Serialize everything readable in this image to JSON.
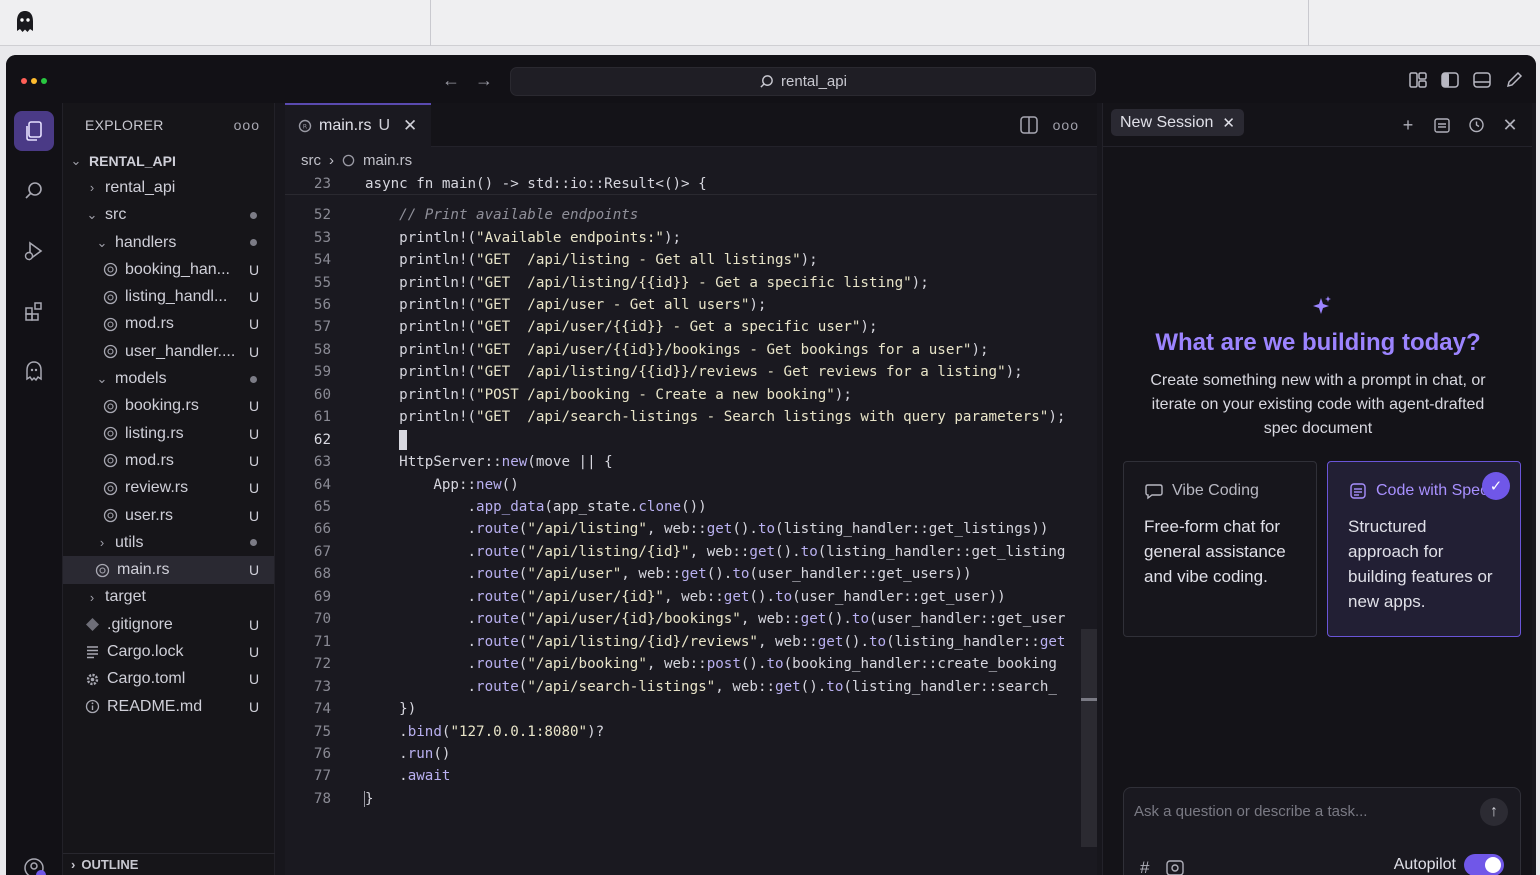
{
  "window": {
    "search_text": "rental_api"
  },
  "explorer": {
    "title": "EXPLORER",
    "more": "ooo",
    "root": "RENTAL_API",
    "items": [
      {
        "label": "rental_api",
        "indent": 1,
        "type": "folder-closed",
        "badge": ""
      },
      {
        "label": "src",
        "indent": 1,
        "type": "folder-open",
        "badge": "dot"
      },
      {
        "label": "handlers",
        "indent": 2,
        "type": "folder-open",
        "badge": "dot"
      },
      {
        "label": "booking_han...",
        "indent": 3,
        "type": "rs",
        "badge": "U"
      },
      {
        "label": "listing_handl...",
        "indent": 3,
        "type": "rs",
        "badge": "U"
      },
      {
        "label": "mod.rs",
        "indent": 3,
        "type": "rs",
        "badge": "U"
      },
      {
        "label": "user_handler....",
        "indent": 3,
        "type": "rs",
        "badge": "U"
      },
      {
        "label": "models",
        "indent": 2,
        "type": "folder-open",
        "badge": "dot"
      },
      {
        "label": "booking.rs",
        "indent": 3,
        "type": "rs",
        "badge": "U"
      },
      {
        "label": "listing.rs",
        "indent": 3,
        "type": "rs",
        "badge": "U"
      },
      {
        "label": "mod.rs",
        "indent": 3,
        "type": "rs",
        "badge": "U"
      },
      {
        "label": "review.rs",
        "indent": 3,
        "type": "rs",
        "badge": "U"
      },
      {
        "label": "user.rs",
        "indent": 3,
        "type": "rs",
        "badge": "U"
      },
      {
        "label": "utils",
        "indent": 2,
        "type": "folder-closed",
        "badge": "dot"
      },
      {
        "label": "main.rs",
        "indent": 2,
        "type": "rs",
        "badge": "U",
        "selected": true
      },
      {
        "label": "target",
        "indent": 1,
        "type": "folder-closed",
        "badge": ""
      },
      {
        "label": ".gitignore",
        "indent": 1,
        "type": "git",
        "badge": "U"
      },
      {
        "label": "Cargo.lock",
        "indent": 1,
        "type": "lock",
        "badge": "U"
      },
      {
        "label": "Cargo.toml",
        "indent": 1,
        "type": "gear",
        "badge": "U"
      },
      {
        "label": "README.md",
        "indent": 1,
        "type": "info",
        "badge": "U"
      }
    ],
    "outline": "OUTLINE"
  },
  "editor": {
    "tab_label": "main.rs",
    "tab_status": "U",
    "tab_close": "✕",
    "breadcrumb": [
      "src",
      "main.rs"
    ],
    "sticky_line": {
      "num": "23",
      "text": "async fn main() -> std::io::Result<()> {"
    },
    "lines": [
      {
        "num": "52",
        "text": "    // Print available endpoints",
        "kind": "comment"
      },
      {
        "num": "53",
        "text": "    println!(\"Available endpoints:\");"
      },
      {
        "num": "54",
        "text": "    println!(\"GET  /api/listing - Get all listings\");"
      },
      {
        "num": "55",
        "text": "    println!(\"GET  /api/listing/{{id}} - Get a specific listing\");"
      },
      {
        "num": "56",
        "text": "    println!(\"GET  /api/user - Get all users\");"
      },
      {
        "num": "57",
        "text": "    println!(\"GET  /api/user/{{id}} - Get a specific user\");"
      },
      {
        "num": "58",
        "text": "    println!(\"GET  /api/user/{{id}}/bookings - Get bookings for a user\");"
      },
      {
        "num": "59",
        "text": "    println!(\"GET  /api/listing/{{id}}/reviews - Get reviews for a listing\");"
      },
      {
        "num": "60",
        "text": "    println!(\"POST /api/booking - Create a new booking\");"
      },
      {
        "num": "61",
        "text": "    println!(\"GET  /api/search-listings - Search listings with query parameters\");"
      },
      {
        "num": "62",
        "text": "",
        "kind": "cursor"
      },
      {
        "num": "63",
        "text": "    HttpServer::new(move || {"
      },
      {
        "num": "64",
        "text": "        App::new()"
      },
      {
        "num": "65",
        "text": "            .app_data(app_state.clone())"
      },
      {
        "num": "66",
        "text": "            .route(\"/api/listing\", web::get().to(listing_handler::get_listings))"
      },
      {
        "num": "67",
        "text": "            .route(\"/api/listing/{id}\", web::get().to(listing_handler::get_listing"
      },
      {
        "num": "68",
        "text": "            .route(\"/api/user\", web::get().to(user_handler::get_users))"
      },
      {
        "num": "69",
        "text": "            .route(\"/api/user/{id}\", web::get().to(user_handler::get_user))"
      },
      {
        "num": "70",
        "text": "            .route(\"/api/user/{id}/bookings\", web::get().to(user_handler::get_user"
      },
      {
        "num": "71",
        "text": "            .route(\"/api/listing/{id}/reviews\", web::get().to(listing_handler::get"
      },
      {
        "num": "72",
        "text": "            .route(\"/api/booking\", web::post().to(booking_handler::create_booking"
      },
      {
        "num": "73",
        "text": "            .route(\"/api/search-listings\", web::get().to(listing_handler::search_"
      },
      {
        "num": "74",
        "text": "    })"
      },
      {
        "num": "75",
        "text": "    .bind(\"127.0.0.1:8080\")?"
      },
      {
        "num": "76",
        "text": "    .run()"
      },
      {
        "num": "77",
        "text": "    .await"
      },
      {
        "num": "78",
        "text": "}",
        "kind": "brace"
      }
    ]
  },
  "chat": {
    "session_tab": "New Session",
    "hero_title": "What are we building today?",
    "hero_subtitle": "Create something new with a prompt in chat, or iterate on your existing code with agent-drafted spec document",
    "cards": [
      {
        "title": "Vibe Coding",
        "description": "Free-form chat for general assistance and vibe coding."
      },
      {
        "title": "Code with Spec",
        "description": "Structured approach for building features or new apps."
      }
    ],
    "input_placeholder": "Ask a question or describe a task...",
    "autopilot_label": "Autopilot",
    "autopilot_on": true
  },
  "colors": {
    "accent": "#7057e8",
    "accent_text": "#9c84ff",
    "background": "#17161c"
  }
}
